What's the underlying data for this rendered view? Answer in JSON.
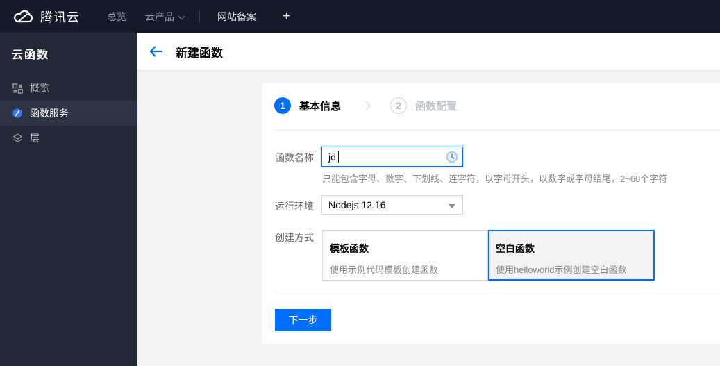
{
  "topbar": {
    "brand": "腾讯云",
    "overview": "总览",
    "products": "云产品",
    "icp": "网站备案",
    "plus": "+"
  },
  "sidebar": {
    "title": "云函数",
    "items": [
      {
        "label": "概览",
        "icon": "grid-icon",
        "active": false
      },
      {
        "label": "函数服务",
        "icon": "scf-hexagon-icon",
        "active": true
      },
      {
        "label": "层",
        "icon": "layers-icon",
        "active": false
      }
    ]
  },
  "header": {
    "title": "新建函数"
  },
  "wizard": {
    "step1": {
      "num": "1",
      "label": "基本信息"
    },
    "step2": {
      "num": "2",
      "label": "函数配置"
    }
  },
  "form": {
    "name_label": "函数名称",
    "name_value": "jd",
    "name_help": "只能包含字母、数字、下划线、连字符，以字母开头，以数字或字母结尾，2~60个字符",
    "runtime_label": "运行环境",
    "runtime_value": "Nodejs 12.16",
    "method_label": "创建方式",
    "cards": [
      {
        "title": "模板函数",
        "desc": "使用示例代码模板创建函数",
        "selected": false
      },
      {
        "title": "空白函数",
        "desc": "使用helloworld示例创建空白函数",
        "selected": true
      }
    ]
  },
  "actions": {
    "next_label": "下一步"
  },
  "colors": {
    "accent": "#006eff",
    "topbar_bg": "#141a27",
    "sidebar_bg": "#222936"
  }
}
